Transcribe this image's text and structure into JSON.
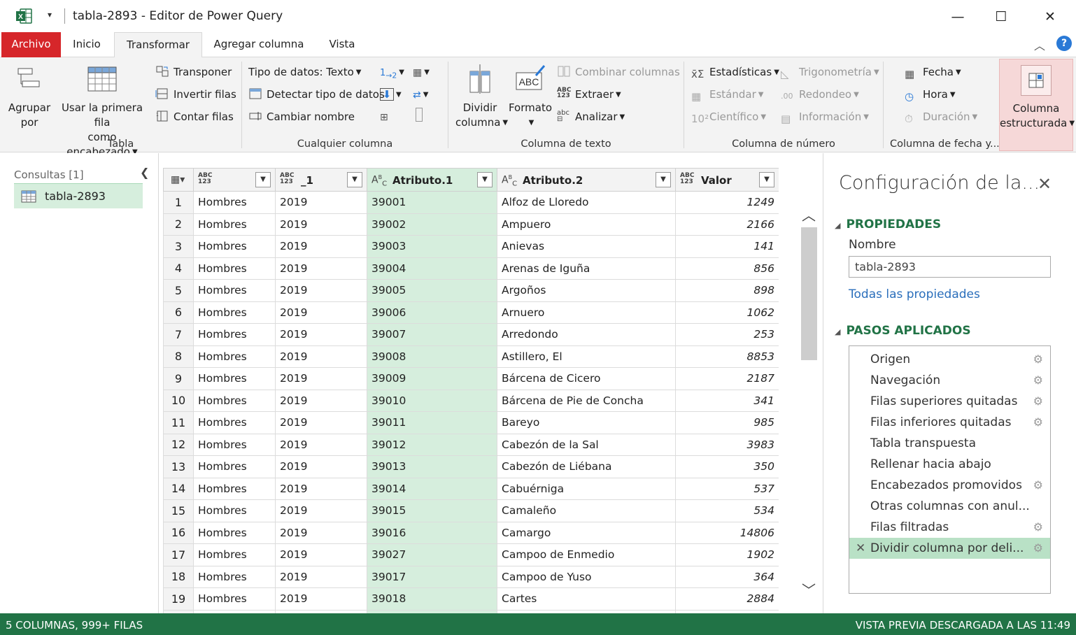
{
  "window": {
    "title": "tabla-2893 - Editor de Power Query",
    "qat_arrow": "▾",
    "minimize": "—",
    "maximize": "☐",
    "close": "✕"
  },
  "tabs": [
    {
      "label": "Archivo"
    },
    {
      "label": "Inicio"
    },
    {
      "label": "Transformar",
      "active": true
    },
    {
      "label": "Agregar columna"
    },
    {
      "label": "Vista"
    }
  ],
  "ribbon": {
    "tabla": {
      "label": "Tabla",
      "agrupar": "Agrupar\npor",
      "agrupar_l1": "Agrupar",
      "agrupar_l2": "por",
      "usar_l1": "Usar la primera fila",
      "usar_l2": "como encabezado",
      "transponer": "Transponer",
      "invertir": "Invertir filas",
      "contar": "Contar filas"
    },
    "cualquier": {
      "label": "Cualquier columna",
      "tipo_datos": "Tipo de datos: Texto",
      "detectar": "Detectar tipo de datos",
      "cambiar": "Cambiar nombre"
    },
    "texto": {
      "label": "Columna de texto",
      "dividir_l1": "Dividir",
      "dividir_l2": "columna",
      "formato": "Formato",
      "combinar": "Combinar columnas",
      "extraer": "Extraer",
      "analizar": "Analizar"
    },
    "numero": {
      "label": "Columna de número",
      "estadisticas": "Estadísticas",
      "estandar": "Estándar",
      "cientifico": "Científico",
      "trigonometria": "Trigonometría",
      "redondeo": "Redondeo",
      "informacion": "Información"
    },
    "fecha": {
      "label": "Columna de fecha y...",
      "fecha": "Fecha",
      "hora": "Hora",
      "duracion": "Duración"
    },
    "estructurada": {
      "l1": "Columna",
      "l2": "estructurada"
    }
  },
  "queries": {
    "header": "Consultas [1]",
    "items": [
      {
        "label": "tabla-2893"
      }
    ]
  },
  "grid": {
    "columns": [
      {
        "type": "ABC\n123",
        "name": ""
      },
      {
        "type": "ABC\n123",
        "name": "_1"
      },
      {
        "type": "ABC",
        "name": "Atributo.1"
      },
      {
        "type": "ABC",
        "name": "Atributo.2"
      },
      {
        "type": "ABC\n123",
        "name": "Valor"
      }
    ],
    "rows": [
      [
        "1",
        "Hombres",
        "2019",
        "39001",
        "Alfoz de Lloredo",
        "1249"
      ],
      [
        "2",
        "Hombres",
        "2019",
        "39002",
        "Ampuero",
        "2166"
      ],
      [
        "3",
        "Hombres",
        "2019",
        "39003",
        "Anievas",
        "141"
      ],
      [
        "4",
        "Hombres",
        "2019",
        "39004",
        "Arenas de Iguña",
        "856"
      ],
      [
        "5",
        "Hombres",
        "2019",
        "39005",
        "Argoños",
        "898"
      ],
      [
        "6",
        "Hombres",
        "2019",
        "39006",
        "Arnuero",
        "1062"
      ],
      [
        "7",
        "Hombres",
        "2019",
        "39007",
        "Arredondo",
        "253"
      ],
      [
        "8",
        "Hombres",
        "2019",
        "39008",
        "Astillero, El",
        "8853"
      ],
      [
        "9",
        "Hombres",
        "2019",
        "39009",
        "Bárcena de Cicero",
        "2187"
      ],
      [
        "10",
        "Hombres",
        "2019",
        "39010",
        "Bárcena de Pie de Concha",
        "341"
      ],
      [
        "11",
        "Hombres",
        "2019",
        "39011",
        "Bareyo",
        "985"
      ],
      [
        "12",
        "Hombres",
        "2019",
        "39012",
        "Cabezón de la Sal",
        "3983"
      ],
      [
        "13",
        "Hombres",
        "2019",
        "39013",
        "Cabezón de Liébana",
        "350"
      ],
      [
        "14",
        "Hombres",
        "2019",
        "39014",
        "Cabuérniga",
        "537"
      ],
      [
        "15",
        "Hombres",
        "2019",
        "39015",
        "Camaleño",
        "534"
      ],
      [
        "16",
        "Hombres",
        "2019",
        "39016",
        "Camargo",
        "14806"
      ],
      [
        "17",
        "Hombres",
        "2019",
        "39027",
        "Campoo de Enmedio",
        "1902"
      ],
      [
        "18",
        "Hombres",
        "2019",
        "39017",
        "Campoo de Yuso",
        "364"
      ],
      [
        "19",
        "Hombres",
        "2019",
        "39018",
        "Cartes",
        "2884"
      ],
      [
        "",
        "",
        "",
        "",
        "",
        ""
      ]
    ]
  },
  "settings": {
    "title": "Configuración de la...",
    "close": "✕",
    "properties_header": "PROPIEDADES",
    "name_label": "Nombre",
    "name_value": "tabla-2893",
    "all_props": "Todas las propiedades",
    "steps_header": "PASOS APLICADOS",
    "steps": [
      {
        "label": "Origen",
        "gear": true
      },
      {
        "label": "Navegación",
        "gear": true
      },
      {
        "label": "Filas superiores quitadas",
        "gear": true
      },
      {
        "label": "Filas inferiores quitadas",
        "gear": true
      },
      {
        "label": "Tabla transpuesta",
        "gear": false
      },
      {
        "label": "Rellenar hacia abajo",
        "gear": false
      },
      {
        "label": "Encabezados promovidos",
        "gear": true
      },
      {
        "label": "Otras columnas con anul...",
        "gear": false
      },
      {
        "label": "Filas filtradas",
        "gear": true
      },
      {
        "label": "Dividir columna por deli...",
        "gear": true,
        "active": true
      }
    ]
  },
  "status": {
    "left": "5 COLUMNAS, 999+ FILAS",
    "right": "VISTA PREVIA DESCARGADA A LAS 11:49"
  },
  "colors": {
    "accent_green": "#217346",
    "file_tab": "#d6262a",
    "selection": "#d6eedd"
  }
}
